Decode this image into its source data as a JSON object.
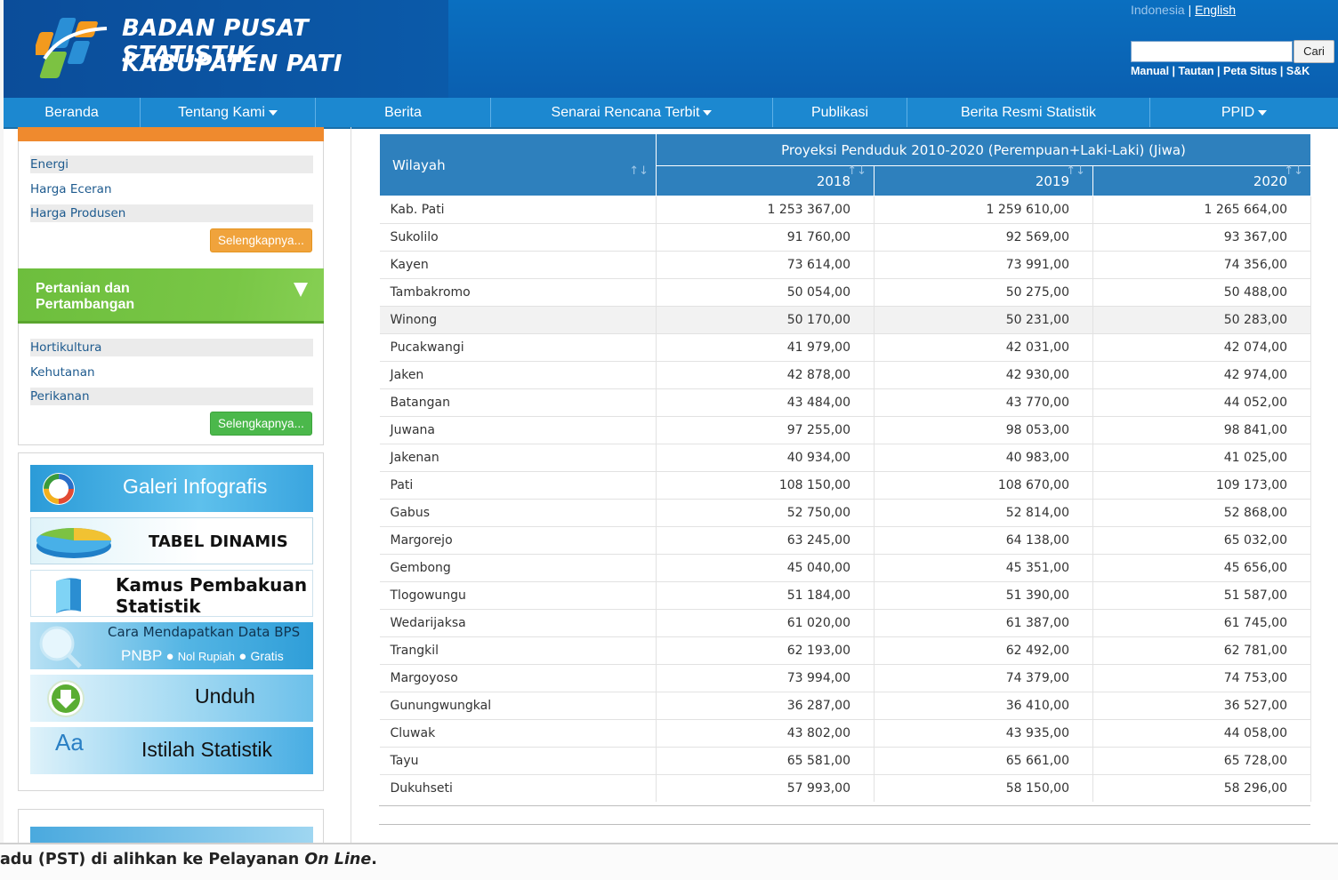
{
  "brand": {
    "line1": "BADAN PUSAT STATISTIK",
    "line2": "KABUPATEN PATI"
  },
  "lang": {
    "indonesia": "Indonesia",
    "separator": " | ",
    "english": "English"
  },
  "search": {
    "button": "Cari",
    "value": ""
  },
  "util_links": [
    "Manual",
    "Tautan",
    "Peta Situs",
    "S&K"
  ],
  "nav": [
    {
      "label": "Beranda",
      "dropdown": false
    },
    {
      "label": "Tentang Kami",
      "dropdown": true
    },
    {
      "label": "Berita",
      "dropdown": false
    },
    {
      "label": "Senarai Rencana Terbit",
      "dropdown": true
    },
    {
      "label": "Publikasi",
      "dropdown": false
    },
    {
      "label": "Berita Resmi Statistik",
      "dropdown": false
    },
    {
      "label": "PPID",
      "dropdown": true
    }
  ],
  "sidebar": {
    "section1_links": [
      "Energi",
      "Harga Eceran",
      "Harga Produsen"
    ],
    "more_label": "Selengkapnya...",
    "section2_title_1": "Pertanian dan",
    "section2_title_2": "Pertambangan",
    "section2_links": [
      "Hortikultura",
      "Kehutanan",
      "Perikanan"
    ],
    "banners": {
      "infografis": "Galeri Infografis",
      "tabel": "TABEL DINAMIS",
      "kamus_1": "Kamus Pembakuan",
      "kamus_2": "Statistik",
      "cara_1": "Cara Mendapatkan Data BPS",
      "cara_pnbp": "PNBP",
      "cara_nol": "Nol Rupiah",
      "cara_gratis": "Gratis",
      "unduh": "Unduh",
      "istilah_icon": "Aa",
      "istilah": "Istilah Statistik"
    }
  },
  "table": {
    "col_region": "Wilayah",
    "group_header": "Proyeksi Penduduk 2010-2020 (Perempuan+Laki-Laki) (Jiwa)",
    "years": [
      "2018",
      "2019",
      "2020"
    ],
    "sort_icon": "↑↓",
    "rows": [
      [
        "Kab. Pati",
        "1 253 367,00",
        "1 259 610,00",
        "1 265 664,00"
      ],
      [
        "Sukolilo",
        "91 760,00",
        "92 569,00",
        "93 367,00"
      ],
      [
        "Kayen",
        "73 614,00",
        "73 991,00",
        "74 356,00"
      ],
      [
        "Tambakromo",
        "50 054,00",
        "50 275,00",
        "50 488,00"
      ],
      [
        "Winong",
        "50 170,00",
        "50 231,00",
        "50 283,00"
      ],
      [
        "Pucakwangi",
        "41 979,00",
        "42 031,00",
        "42 074,00"
      ],
      [
        "Jaken",
        "42 878,00",
        "42 930,00",
        "42 974,00"
      ],
      [
        "Batangan",
        "43 484,00",
        "43 770,00",
        "44 052,00"
      ],
      [
        "Juwana",
        "97 255,00",
        "98 053,00",
        "98 841,00"
      ],
      [
        "Jakenan",
        "40 934,00",
        "40 983,00",
        "41 025,00"
      ],
      [
        "Pati",
        "108 150,00",
        "108 670,00",
        "109 173,00"
      ],
      [
        "Gabus",
        "52 750,00",
        "52 814,00",
        "52 868,00"
      ],
      [
        "Margorejo",
        "63 245,00",
        "64 138,00",
        "65 032,00"
      ],
      [
        "Gembong",
        "45 040,00",
        "45 351,00",
        "45 656,00"
      ],
      [
        "Tlogowungu",
        "51 184,00",
        "51 390,00",
        "51 587,00"
      ],
      [
        "Wedarijaksa",
        "61 020,00",
        "61 387,00",
        "61 745,00"
      ],
      [
        "Trangkil",
        "62 193,00",
        "62 492,00",
        "62 781,00"
      ],
      [
        "Margoyoso",
        "73 994,00",
        "74 379,00",
        "74 753,00"
      ],
      [
        "Gunungwungkal",
        "36 287,00",
        "36 410,00",
        "36 527,00"
      ],
      [
        "Cluwak",
        "43 802,00",
        "43 935,00",
        "44 058,00"
      ],
      [
        "Tayu",
        "65 581,00",
        "65 661,00",
        "65 728,00"
      ],
      [
        "Dukuhseti",
        "57 993,00",
        "58 150,00",
        "58 296,00"
      ]
    ],
    "highlight_row": "Winong"
  },
  "ticker": {
    "text_before": "adu (PST) di alihkan ke Pelayanan ",
    "text_em": "On Line",
    "text_after": "."
  },
  "colors": {
    "header_blue": "#0a5fb0",
    "nav_blue": "#1c88d0",
    "table_head": "#2e80bd",
    "green": "#79c746",
    "orange": "#ef8a2e"
  },
  "icons": [
    "bps-logo-icon",
    "caret-down-icon",
    "sort-icon",
    "triangle-down-icon",
    "infografis-icon",
    "pie-chart-icon",
    "book-icon",
    "magnifier-icon",
    "download-arrow-icon"
  ]
}
